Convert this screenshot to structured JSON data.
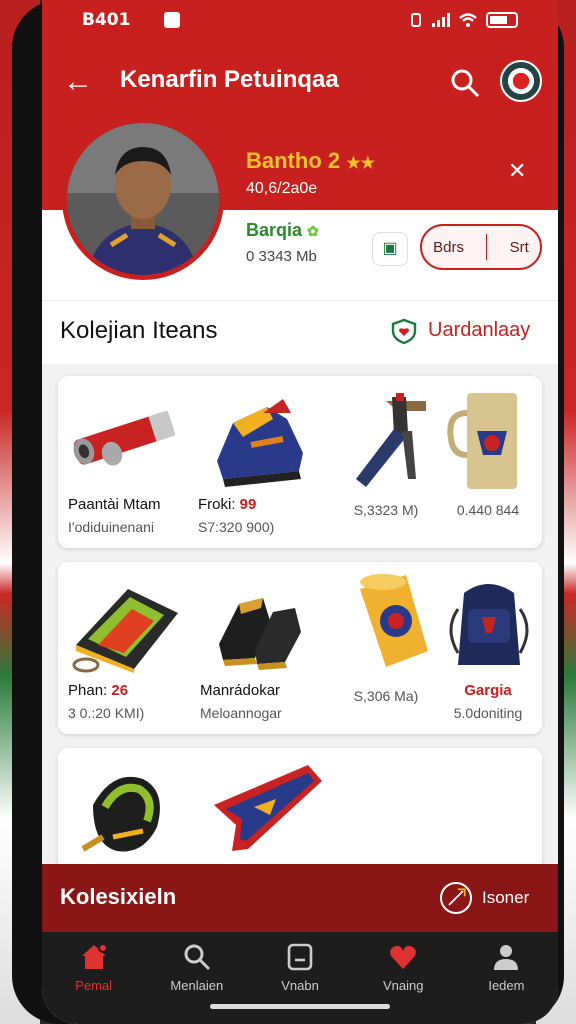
{
  "status": {
    "time": "B401"
  },
  "header": {
    "title": "Kenarfin Petuinqaa",
    "player_name": "Bantho 2",
    "player_stars": "★★",
    "player_sub": "40,6/2a0e",
    "team_name": "Barqia",
    "team_sub": "0 3343 Mb",
    "pill_left": "Bdrs",
    "pill_right": "Srt"
  },
  "collection": {
    "title": "Kolejian Iteans",
    "link": "Uardanlaay"
  },
  "items_row1": [
    {
      "name": "Paantài Mtam",
      "sub": "I'odiduinenani",
      "icon": "bat-icon"
    },
    {
      "name": "Froki: ",
      "accent": "99",
      "sub": "S7:320 900)",
      "icon": "boot-icon"
    },
    {
      "name": "",
      "sub": "S,3323 M)",
      "icon": "torch-icon"
    },
    {
      "name": "",
      "sub": "0.440 844",
      "icon": "mug-icon"
    }
  ],
  "items_row2": [
    {
      "name": "Phan: ",
      "accent": "26",
      "sub": "3 0.:20 KMI)",
      "icon": "bag-icon"
    },
    {
      "name": "Manrádokar",
      "sub": "Meloannogar",
      "icon": "shoes-icon"
    },
    {
      "name": "",
      "sub": "S,306 Ma)",
      "icon": "cup-icon"
    },
    {
      "name": "",
      "accent": "Gargia",
      "sub": "5.0doniting",
      "icon": "backpack-icon"
    }
  ],
  "items_row3": [
    {
      "icon": "glove-icon"
    },
    {
      "icon": "scarf-icon"
    }
  ],
  "banner": {
    "title": "Kolesixieln",
    "link": "Isoner"
  },
  "nav": [
    {
      "label": "Pemal",
      "icon": "home-icon"
    },
    {
      "label": "Menlaien",
      "icon": "search-icon"
    },
    {
      "label": "Vnabn",
      "icon": "tablet-icon"
    },
    {
      "label": "Vnaing",
      "icon": "heart-icon"
    },
    {
      "label": "Iedem",
      "icon": "person-icon"
    }
  ]
}
